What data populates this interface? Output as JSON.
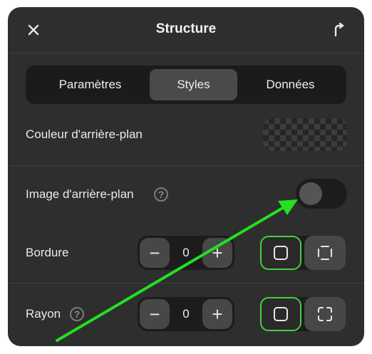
{
  "header": {
    "title": "Structure",
    "close_icon": "close-icon",
    "publish_icon": "share-arrow-icon"
  },
  "tabs": [
    {
      "label": "Paramètres",
      "active": false
    },
    {
      "label": "Styles",
      "active": true
    },
    {
      "label": "Données",
      "active": false
    }
  ],
  "rows": {
    "background_color": {
      "label": "Couleur d'arrière-plan"
    },
    "background_image": {
      "label": "Image d'arrière-plan",
      "help": "?",
      "enabled": false
    },
    "border": {
      "label": "Bordure",
      "value": "0",
      "minus": "−",
      "plus": "+"
    },
    "radius": {
      "label": "Rayon",
      "help": "?",
      "value": "0",
      "minus": "−",
      "plus": "+"
    }
  },
  "colors": {
    "panel_bg": "#2e2e2e",
    "accent_green": "#46d03d",
    "annotation_arrow": "#22e022"
  }
}
